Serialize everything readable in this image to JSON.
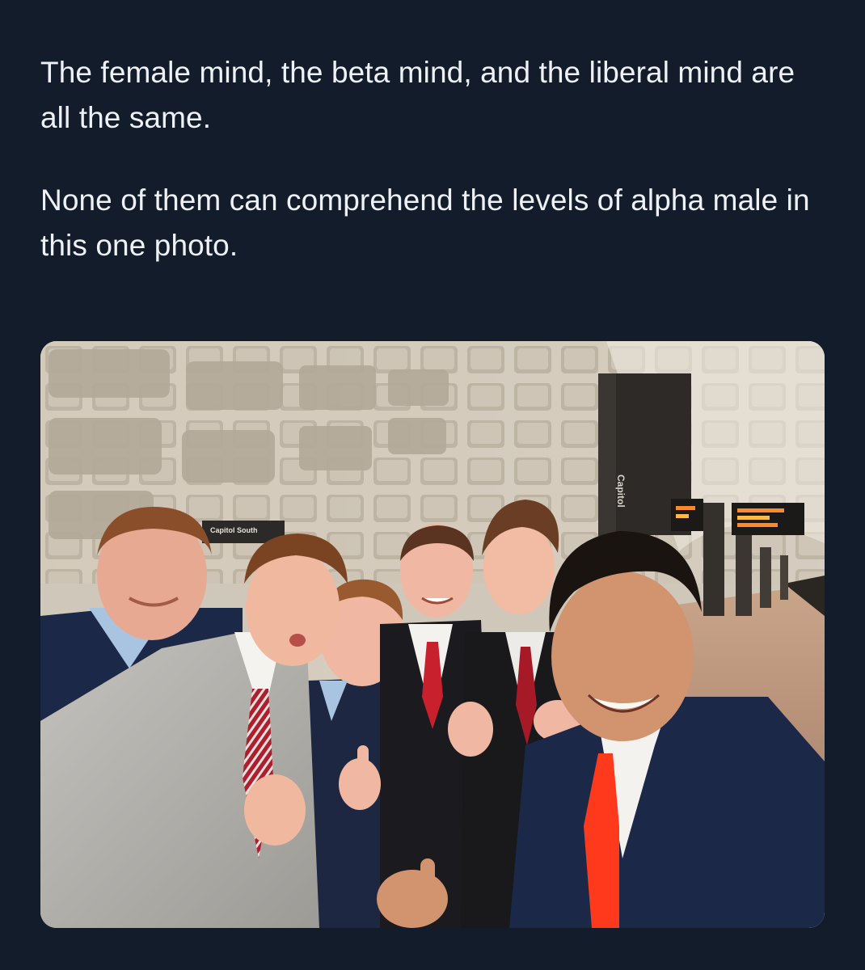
{
  "post": {
    "paragraphs": [
      "The female mind, the beta mind, and the liberal mind are all the same.",
      "None of them can comprehend the levels of alpha male in this one photo."
    ]
  },
  "photo": {
    "station_sign": "Capitol South",
    "pillar_label": "Capitol",
    "colors": {
      "background": "#131c2b",
      "text": "#eef1f5",
      "ceiling": "#cfc6b8",
      "red_tie": "#c8202c",
      "orange_tie": "#ff3a1c",
      "navy_suit": "#1c2848",
      "gray_suit": "#b7b5b0"
    }
  }
}
